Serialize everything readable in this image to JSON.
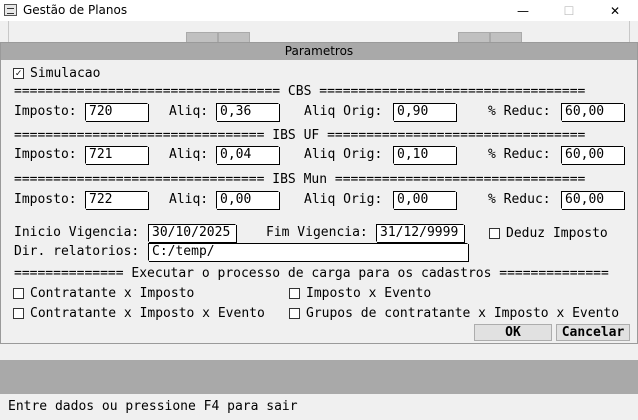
{
  "window": {
    "title": "Gestão de Planos",
    "min_icon": "—",
    "max_icon": "☐",
    "close_icon": "✕"
  },
  "dialog": {
    "title": "Parametros",
    "simulacao": {
      "label": "Simulacao",
      "checked": true
    },
    "sections": [
      {
        "header": "================================== CBS ==================================",
        "imposto_label": "Imposto:",
        "imposto": "720",
        "aliq_label": "Aliq:",
        "aliq": "0,36",
        "aliq_orig_label": "Aliq Orig:",
        "aliq_orig": "0,90",
        "reduc_label": "% Reduc:",
        "reduc": "60,00"
      },
      {
        "header": "================================ IBS UF =================================",
        "imposto_label": "Imposto:",
        "imposto": "721",
        "aliq_label": "Aliq:",
        "aliq": "0,04",
        "aliq_orig_label": "Aliq Orig:",
        "aliq_orig": "0,10",
        "reduc_label": "% Reduc:",
        "reduc": "60,00"
      },
      {
        "header": "================================ IBS Mun ================================",
        "imposto_label": "Imposto:",
        "imposto": "722",
        "aliq_label": "Aliq:",
        "aliq": "0,00",
        "aliq_orig_label": "Aliq Orig:",
        "aliq_orig": "0,00",
        "reduc_label": "% Reduc:",
        "reduc": "60,00"
      }
    ],
    "inicio_label": "Inicio Vigencia:",
    "inicio": "30/10/2025",
    "fim_label": "Fim Vigencia:",
    "fim": "31/12/9999",
    "deduz": {
      "label": "Deduz Imposto",
      "checked": false
    },
    "dir_label": "Dir. relatorios:",
    "dir": "C:/temp/",
    "carga_header": "============== Executar o processo de carga para os cadastros ==============",
    "opts": [
      {
        "label": "Contratante x Imposto",
        "checked": false
      },
      {
        "label": "Imposto x Evento",
        "checked": false
      },
      {
        "label": "Contratante x Imposto x Evento",
        "checked": false
      },
      {
        "label": "Grupos de contratante x Imposto x Evento",
        "checked": false
      }
    ],
    "ok_label": "OK",
    "cancel_label": "Cancelar"
  },
  "status": "Entre dados ou pressione F4 para sair"
}
